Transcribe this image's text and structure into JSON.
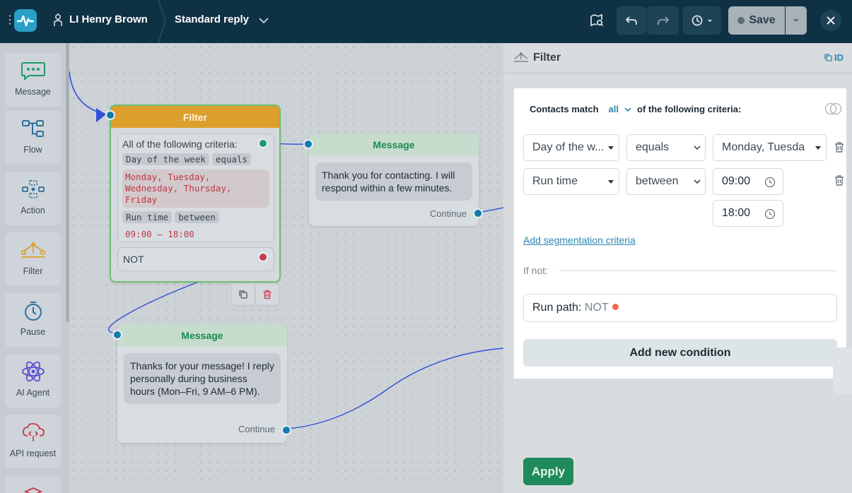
{
  "topbar": {
    "bot_name": "LI Henry Brown",
    "flow_name": "Standard reply",
    "save_label": "Save",
    "icons": [
      "app-logo-icon",
      "bot-icon",
      "chevron-down-icon",
      "preview-icon",
      "undo-icon",
      "redo-icon",
      "history-icon",
      "close-icon"
    ]
  },
  "sidebar": {
    "tools": [
      {
        "label": "Message",
        "icon": "message-icon"
      },
      {
        "label": "Flow",
        "icon": "flow-icon"
      },
      {
        "label": "Action",
        "icon": "action-icon"
      },
      {
        "label": "Filter",
        "icon": "filter-icon"
      },
      {
        "label": "Pause",
        "icon": "timer-icon"
      },
      {
        "label": "AI Agent",
        "icon": "ai-agent-icon"
      },
      {
        "label": "API request",
        "icon": "api-request-icon"
      }
    ]
  },
  "canvas": {
    "filter_node": {
      "title": "Filter",
      "criteria_title": "All of the following criteria:",
      "field1": "Day of the week",
      "op1": "equals",
      "days": "Monday, Tuesday, Wednesday, Thursday, Friday",
      "field2": "Run time",
      "op2": "between",
      "time_range": "09:00 — 18:00",
      "not_label": "NOT"
    },
    "message_node_1": {
      "title": "Message",
      "text": "Thank you for contacting. I will respond within a few minutes.",
      "continue": "Continue"
    },
    "message_node_2": {
      "title": "Message",
      "text": "Thanks for your message! I reply personally during business hours (Mon–Fri, 9 AM–6 PM).",
      "continue": "Continue"
    },
    "colors": {
      "filter_header": "#dc9f2c",
      "message_title": "#1b8a4f",
      "wire": "#2f4fd6",
      "port": "#127cab"
    }
  },
  "panel": {
    "title": "Filter",
    "id_label": "ID",
    "match_prefix": "Contacts match",
    "match_value": "all",
    "match_suffix": "of the following criteria:",
    "rows": [
      {
        "field": "Day of the w...",
        "operator": "equals",
        "value": "Monday, Tuesda"
      },
      {
        "field": "Run time",
        "operator": "between",
        "from": "09:00",
        "to": "18:00"
      }
    ],
    "add_segmentation": "Add segmentation criteria",
    "if_not": "If not:",
    "run_path_label": "Run path:",
    "run_path_value": "NOT",
    "add_condition": "Add new condition",
    "apply": "Apply",
    "accent": "#2b86b0",
    "apply_color": "#1f8a5b"
  }
}
